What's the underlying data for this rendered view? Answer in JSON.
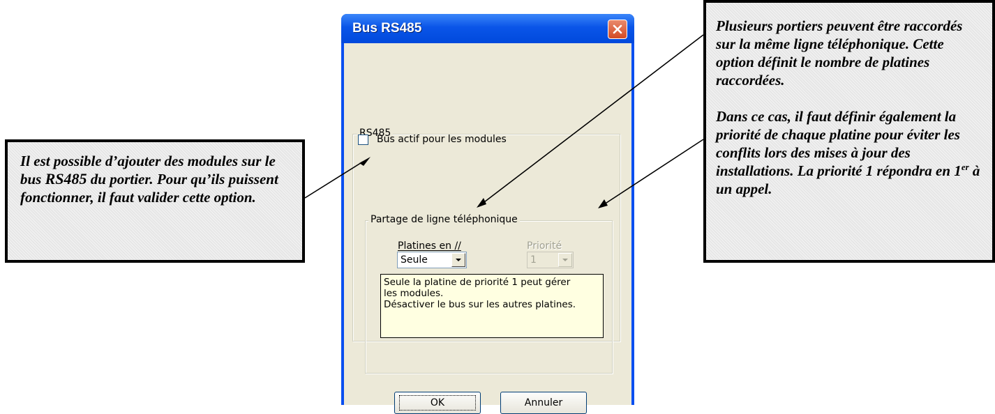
{
  "dialog": {
    "title": "Bus RS485",
    "rs485_group_label": "RS485",
    "bus_checkbox_label": "Bus actif pour les modules",
    "bus_checkbox_checked": false,
    "partage_group_label": "Partage de ligne téléphonique",
    "platines_label": "Platines en //",
    "platines_value": "Seule",
    "priorite_label": "Priorité",
    "priorite_value": "1",
    "info_line1": "Seule la platine de priorité 1 peut gérer",
    "info_line2": "les modules.",
    "info_line3": "Désactiver le bus sur les autres platines.",
    "ok_label": "OK",
    "cancel_label": "Annuler"
  },
  "left_callout": {
    "text1": "Il est possible d’ajouter des modules sur le bus ",
    "bold": "RS485",
    "text2": " du portier. Pour qu’ils puissent fonctionner, il faut valider cette option."
  },
  "right_callout": {
    "para1": "Plusieurs portiers peuvent être raccordés sur la même ligne téléphonique. Cette option définit le nombre de platines raccordées.",
    "para2": "Dans ce cas, il faut définir également la priorité de chaque platine pour éviter les conflits lors des mises à jour des installations. La priorité 1 répondra en 1",
    "para2_sup": "er",
    "para2_end": "  à un appel."
  },
  "icons": {
    "close": "close-icon",
    "dropdown": "chevron-down-icon",
    "arrow": "arrowhead-icon"
  },
  "colors": {
    "titlebar": "#0a55e8",
    "close_button": "#d24a25",
    "dialog_face": "#ece9d8",
    "tooltip_bg": "#ffffe1"
  }
}
